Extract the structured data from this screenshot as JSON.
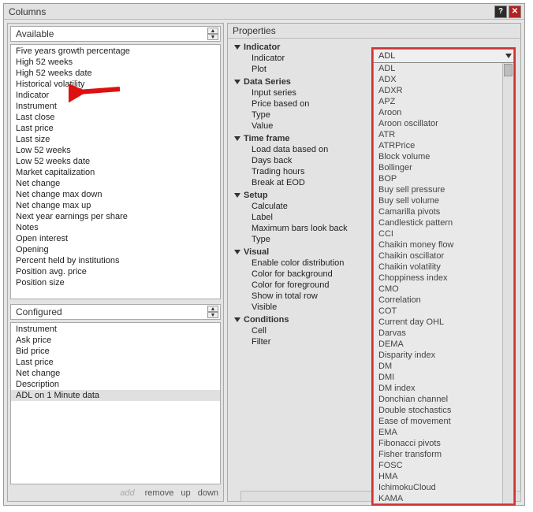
{
  "title": "Columns",
  "left": {
    "available_label": "Available",
    "available_items": [
      "Five years growth percentage",
      "High 52 weeks",
      "High 52 weeks date",
      "Historical volatility",
      "Indicator",
      "Instrument",
      "Last close",
      "Last price",
      "Last size",
      "Low 52 weeks",
      "Low 52 weeks date",
      "Market capitalization",
      "Net change",
      "Net change max down",
      "Net change max up",
      "Next year earnings per share",
      "Notes",
      "Open interest",
      "Opening",
      "Percent held by institutions",
      "Position avg. price",
      "Position size"
    ],
    "configured_label": "Configured",
    "configured_items": [
      "Instrument",
      "Ask price",
      "Bid price",
      "Last price",
      "Net change",
      "Description",
      "ADL on 1 Minute data"
    ],
    "footer": {
      "add": "add",
      "remove": "remove",
      "up": "up",
      "down": "down"
    }
  },
  "right": {
    "panel_label": "Properties",
    "groups": [
      {
        "name": "Indicator",
        "items": [
          "Indicator",
          "Plot"
        ]
      },
      {
        "name": "Data Series",
        "items": [
          "Input series",
          "Price based on",
          "Type",
          "Value"
        ]
      },
      {
        "name": "Time frame",
        "items": [
          "Load data based on",
          "Days back",
          "Trading hours",
          "Break at EOD"
        ]
      },
      {
        "name": "Setup",
        "items": [
          "Calculate",
          "Label",
          "Maximum bars look back",
          "Type"
        ]
      },
      {
        "name": "Visual",
        "items": [
          "Enable color distribution",
          "Color for background",
          "Color for foreground",
          "Show in total row",
          "Visible"
        ]
      },
      {
        "name": "Conditions",
        "items": [
          "Cell",
          "Filter"
        ]
      }
    ],
    "dropdown": {
      "selected": "ADL",
      "options": [
        "ADL",
        "ADX",
        "ADXR",
        "APZ",
        "Aroon",
        "Aroon oscillator",
        "ATR",
        "ATRPrice",
        "Block volume",
        "Bollinger",
        "BOP",
        "Buy sell pressure",
        "Buy sell volume",
        "Camarilla pivots",
        "Candlestick pattern",
        "CCI",
        "Chaikin money flow",
        "Chaikin oscillator",
        "Chaikin volatility",
        "Choppiness index",
        "CMO",
        "Correlation",
        "COT",
        "Current day OHL",
        "Darvas",
        "DEMA",
        "Disparity index",
        "DM",
        "DMI",
        "DM index",
        "Donchian channel",
        "Double stochastics",
        "Ease of movement",
        "EMA",
        "Fibonacci pivots",
        "Fisher transform",
        "FOSC",
        "HMA",
        "IchimokuCloud",
        "KAMA"
      ]
    }
  }
}
